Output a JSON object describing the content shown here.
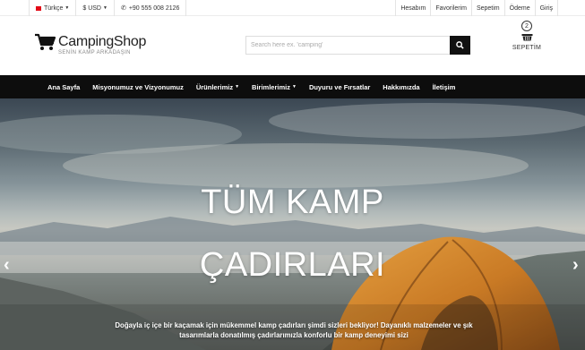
{
  "topbar": {
    "language": "Türkçe",
    "currency": "$ USD",
    "phone": "+90 555 008 2126",
    "links": [
      "Hesabım",
      "Favorilerim",
      "Sepetim",
      "Ödeme",
      "Giriş"
    ]
  },
  "header": {
    "logo_title": "CampingShop",
    "logo_subtitle": "SENİN KAMP ARKADAŞIN",
    "search_placeholder": "Search here ex. 'camping'",
    "basket_count": "2",
    "basket_label": "SEPETİM"
  },
  "nav": {
    "items": [
      "Ana Sayfa",
      "Misyonumuz ve Vizyonumuz",
      "Ürünlerimiz",
      "Birimlerimiz",
      "Duyuru ve Fırsatlar",
      "Hakkımızda",
      "İletişim"
    ]
  },
  "hero": {
    "title_line1": "TÜM KAMP",
    "title_line2": "ÇADIRLARI",
    "description": "Doğayla iç içe bir kaçamak için mükemmel kamp çadırları şimdi sizleri bekliyor! Dayanıklı malzemeler ve şık tasarımlarla donatılmış çadırlarımızla konforlu bir kamp deneyimi sizi",
    "prev_arrow": "‹",
    "next_arrow": "›"
  },
  "colors": {
    "nav_bg": "#0d0d0d",
    "tent_orange": "#d98a2c",
    "flag_red": "#e30a17"
  }
}
